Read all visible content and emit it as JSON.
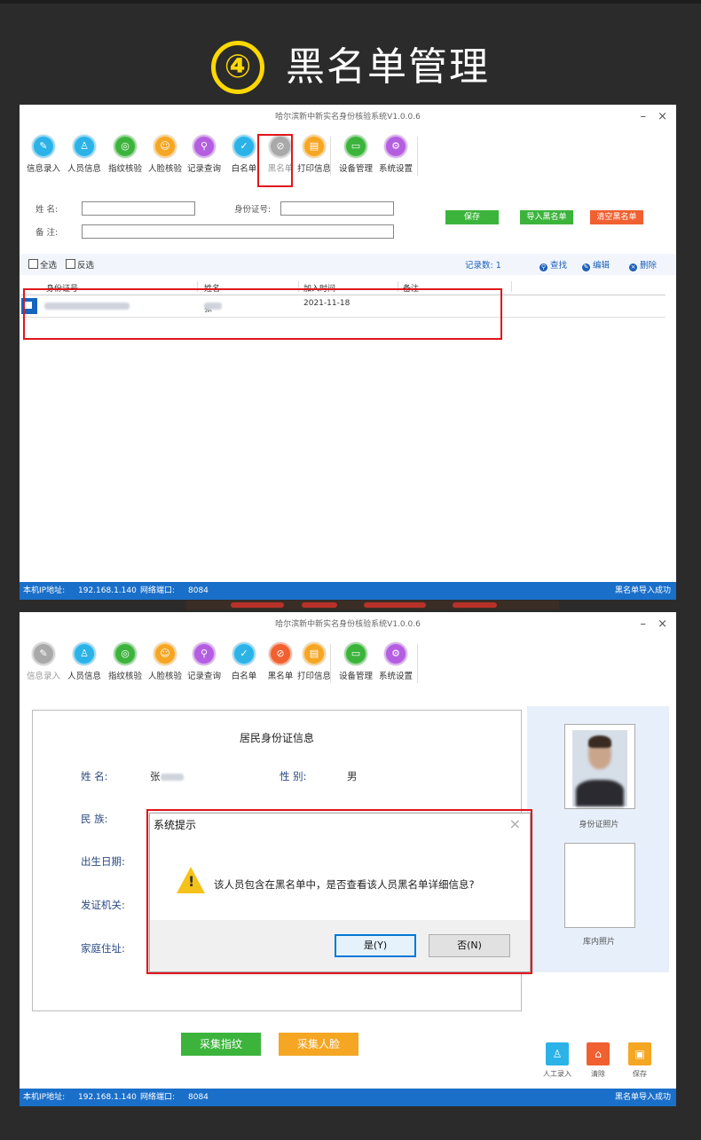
{
  "heading": {
    "number": "④",
    "title": "黑名单管理"
  },
  "window1": {
    "title": "哈尔滨新中新实名身份核验系统V1.0.0.6",
    "controls": {
      "min": "–",
      "close": "×"
    },
    "toolbar": [
      {
        "label": "信息录入",
        "icon": "pencil-icon",
        "color": "#2bb3e8"
      },
      {
        "label": "人员信息",
        "icon": "users-icon",
        "color": "#2bb3e8"
      },
      {
        "label": "指纹核验",
        "icon": "fingerprint-icon",
        "color": "#3cb43c"
      },
      {
        "label": "人脸核验",
        "icon": "face-icon",
        "color": "#f5a623"
      },
      {
        "label": "记录查询",
        "icon": "search-icon",
        "color": "#b45ee0"
      },
      {
        "label": "白名单",
        "icon": "check-icon",
        "color": "#2bb3e8"
      },
      {
        "label": "黑名单",
        "icon": "ban-icon",
        "color": "#a9a9a9"
      },
      {
        "label": "打印信息",
        "icon": "print-icon",
        "color": "#f5a623"
      },
      {
        "label": "设备管理",
        "icon": "monitor-icon",
        "color": "#3cb43c"
      },
      {
        "label": "系统设置",
        "icon": "gear-icon",
        "color": "#b45ee0"
      }
    ],
    "form": {
      "name_label": "姓    名:",
      "id_label": "身份证号:",
      "remark_label": "备    注:",
      "save": "保存",
      "import": "导入黑名单",
      "clear": "清空黑名单"
    },
    "listbar": {
      "select_all": "全选",
      "invert": "反选",
      "count": "记录数: 1",
      "find": "查找",
      "edit": "编辑",
      "delete": "删除"
    },
    "table": {
      "headers": [
        "身份证号",
        "姓名",
        "加入时间",
        "备注"
      ],
      "rows": [
        {
          "id": "",
          "name": "张",
          "time": "2021-11-18",
          "remark": ""
        }
      ]
    },
    "status": {
      "ip_label": "本机IP地址:",
      "ip": "192.168.1.140",
      "port_label": "网络端口:",
      "port": "8084",
      "message": "黑名单导入成功"
    }
  },
  "window2": {
    "title": "哈尔滨新中新实名身份核验系统V1.0.0.6",
    "controls": {
      "min": "–",
      "close": "×"
    },
    "toolbar": [
      {
        "label": "信息录入",
        "icon": "pencil-icon",
        "color": "#a9a9a9"
      },
      {
        "label": "人员信息",
        "icon": "users-icon",
        "color": "#2bb3e8"
      },
      {
        "label": "指纹核验",
        "icon": "fingerprint-icon",
        "color": "#3cb43c"
      },
      {
        "label": "人脸核验",
        "icon": "face-icon",
        "color": "#f5a623"
      },
      {
        "label": "记录查询",
        "icon": "search-icon",
        "color": "#b45ee0"
      },
      {
        "label": "白名单",
        "icon": "check-icon",
        "color": "#2bb3e8"
      },
      {
        "label": "黑名单",
        "icon": "ban-icon",
        "color": "#f06030"
      },
      {
        "label": "打印信息",
        "icon": "print-icon",
        "color": "#f5a623"
      },
      {
        "label": "设备管理",
        "icon": "monitor-icon",
        "color": "#3cb43c"
      },
      {
        "label": "系统设置",
        "icon": "gear-icon",
        "color": "#b45ee0"
      }
    ],
    "card": {
      "title": "居民身份证信息",
      "name_label": "姓    名:",
      "name_value": "张",
      "gender_label": "性    别:",
      "gender_value": "男",
      "ethnic_label": "民    族:",
      "birth_label": "出生日期:",
      "authority_label": "发证机关:",
      "address_label": "家庭住址:"
    },
    "photos": {
      "id_photo": "身份证照片",
      "db_photo": "库内照片"
    },
    "buttons": {
      "fingerprint": "采集指纹",
      "face": "采集人脸",
      "manual": "人工录入",
      "clear": "清除",
      "save": "保存"
    },
    "dialog": {
      "title": "系统提示",
      "message": "该人员包含在黑名单中，是否查看该人员黑名单详细信息?",
      "yes": "是(Y)",
      "no": "否(N)",
      "close": "×"
    },
    "status": {
      "ip_label": "本机IP地址:",
      "ip": "192.168.1.140",
      "port_label": "网络端口:",
      "port": "8084",
      "message": "黑名单导入成功"
    }
  },
  "colors": {
    "status_blue": "#1a6fc9",
    "highlight_red": "#e0161b",
    "green_btn": "#3cb43c",
    "orange_btn": "#f06030",
    "yellow_btn": "#f5a623"
  }
}
